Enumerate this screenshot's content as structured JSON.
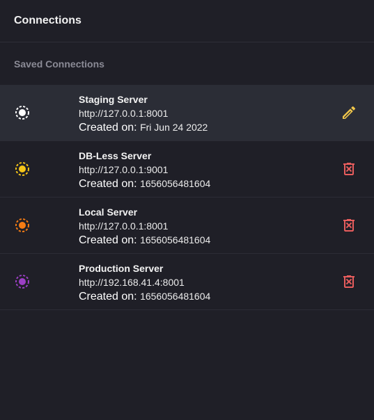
{
  "header": {
    "title": "Connections"
  },
  "section": {
    "label": "Saved Connections"
  },
  "created_prefix": "Created on: ",
  "connections": [
    {
      "name": "Staging Server",
      "url": "http://127.0.0.1:8001",
      "created": "Fri Jun 24 2022",
      "status_color": "#ffffff",
      "action_icon": "pencil-icon",
      "action_color": "#f0c64a",
      "selected": true
    },
    {
      "name": "DB-Less Server",
      "url": "http://127.0.0.1:9001",
      "created": "1656056481604",
      "status_color": "#f5c518",
      "action_icon": "trash-icon",
      "action_color": "#e85d5d",
      "selected": false
    },
    {
      "name": "Local Server",
      "url": "http://127.0.0.1:8001",
      "created": "1656056481604",
      "status_color": "#f57c14",
      "action_icon": "trash-icon",
      "action_color": "#e85d5d",
      "selected": false
    },
    {
      "name": "Production Server",
      "url": "http://192.168.41.4:8001",
      "created": "1656056481604",
      "status_color": "#9b3fc4",
      "action_icon": "trash-icon",
      "action_color": "#e85d5d",
      "selected": false
    }
  ]
}
